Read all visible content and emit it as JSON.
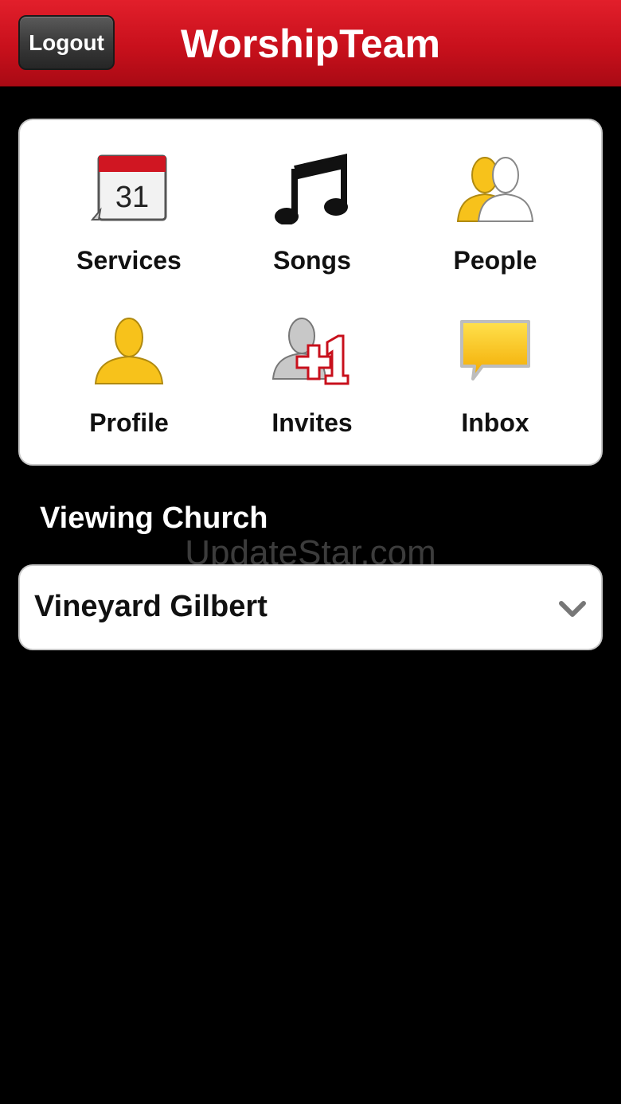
{
  "navbar": {
    "logout_label": "Logout",
    "title": "WorshipTeam",
    "background_color": "#c8101c"
  },
  "menu": {
    "items": [
      {
        "label": "Services",
        "icon": "calendar-icon",
        "calendar_day": "31"
      },
      {
        "label": "Songs",
        "icon": "music-note-icon"
      },
      {
        "label": "People",
        "icon": "people-icon"
      },
      {
        "label": "Profile",
        "icon": "person-icon"
      },
      {
        "label": "Invites",
        "icon": "invite-plus-one-icon",
        "badge_text": "+1"
      },
      {
        "label": "Inbox",
        "icon": "message-bubble-icon"
      }
    ]
  },
  "church": {
    "section_label": "Viewing Church",
    "selected": "Vineyard Gilbert"
  },
  "watermark": "UpdateStar.com",
  "colors": {
    "accent_red": "#c8101c",
    "icon_yellow": "#f7c21b"
  }
}
